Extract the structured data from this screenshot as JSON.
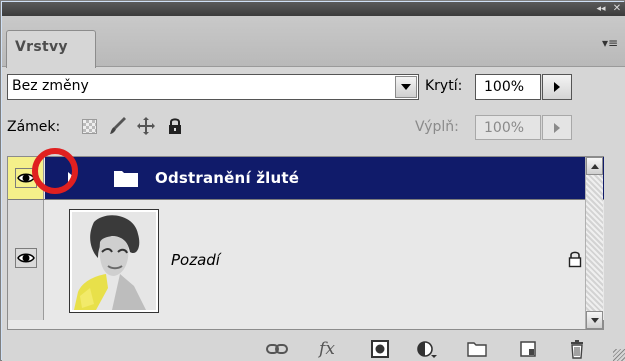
{
  "panel": {
    "tab_label": "Vrstvy",
    "collapse_glyph": "◂◂",
    "close_glyph": "✕",
    "menu_glyph": "▾≡"
  },
  "blend": {
    "mode": "Bez změny",
    "opacity_label": "Krytí:",
    "opacity_value": "100%"
  },
  "lock": {
    "label": "Zámek:",
    "fill_label": "Výplň:",
    "fill_value": "100%",
    "icons": [
      "lock-transparent-pixels-icon",
      "brush-icon",
      "move-icon",
      "lock-icon"
    ]
  },
  "layers": [
    {
      "name": "Odstranění žluté",
      "type": "group",
      "selected": true,
      "visible": true,
      "expanded": false
    },
    {
      "name": "Pozadí",
      "type": "background",
      "selected": false,
      "visible": true,
      "locked": true
    }
  ],
  "toolbar": {
    "buttons": [
      "link-icon",
      "fx-icon",
      "mask-icon",
      "adjustment-layer-icon",
      "new-group-icon",
      "new-layer-icon",
      "trash-icon"
    ],
    "fx_label": "fx"
  },
  "colors": {
    "selection": "#101b6a",
    "eye_highlight": "#f5f08a",
    "annotation_ring": "#e02020"
  }
}
